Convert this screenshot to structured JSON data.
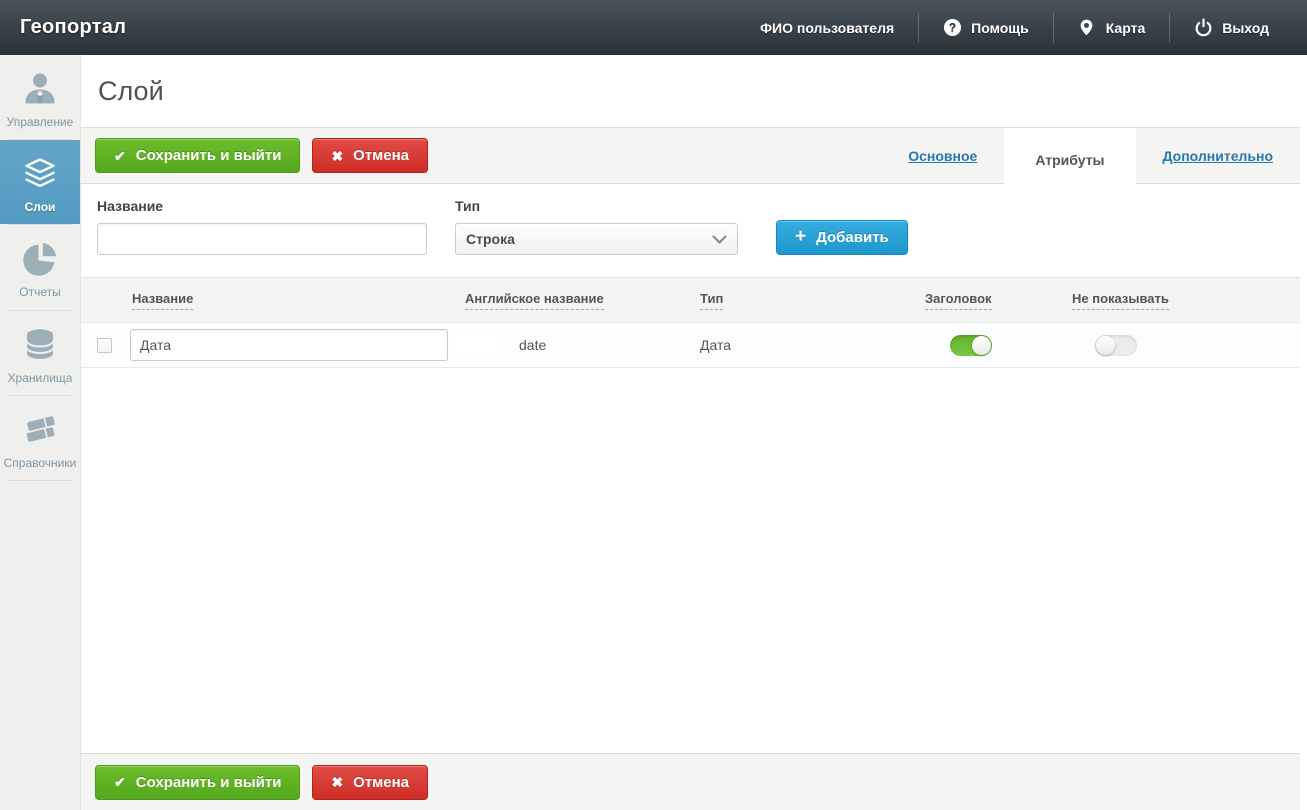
{
  "header": {
    "brand": "Геопортал",
    "user_name": "ФИО пользователя",
    "nav": [
      {
        "label": "Помощь",
        "icon": "help-icon"
      },
      {
        "label": "Карта",
        "icon": "map-pin-icon"
      },
      {
        "label": "Выход",
        "icon": "power-icon"
      }
    ]
  },
  "sidebar": {
    "items": [
      {
        "label": "Управление",
        "icon": "user-icon",
        "active": false
      },
      {
        "label": "Слои",
        "icon": "layers-icon",
        "active": true
      },
      {
        "label": "Отчеты",
        "icon": "pie-chart-icon",
        "active": false
      },
      {
        "label": "Хранилища",
        "icon": "database-icon",
        "active": false
      },
      {
        "label": "Справочники",
        "icon": "books-icon",
        "active": false
      }
    ]
  },
  "page": {
    "title": "Слой"
  },
  "toolbar": {
    "save_label": "Сохранить и выйти",
    "cancel_label": "Отмена",
    "save_icon": "✔",
    "cancel_icon": "✖"
  },
  "tabs": [
    {
      "label": "Основное",
      "active": false
    },
    {
      "label": "Атрибуты",
      "active": true
    },
    {
      "label": "Дополнительно",
      "active": false
    }
  ],
  "form": {
    "name_label": "Название",
    "name_value": "",
    "type_label": "Тип",
    "type_value": "Строка",
    "add_label": "Добавить",
    "add_icon": "+"
  },
  "table": {
    "columns": [
      "Название",
      "Английское название",
      "Тип",
      "Заголовок",
      "Не показывать"
    ],
    "rows": [
      {
        "name": "Дата",
        "english_name": "date",
        "type": "Дата",
        "header_toggle": "on",
        "hide_toggle": "off",
        "checked": false
      }
    ]
  },
  "colors": {
    "header_bg": "#333c42",
    "active_item_bg": "#549ac0",
    "accent_green": "#5fb023",
    "accent_red": "#d63a33",
    "accent_blue": "#27a2d6",
    "link_blue": "#2878b0",
    "toggle_on": "#6cc036"
  }
}
